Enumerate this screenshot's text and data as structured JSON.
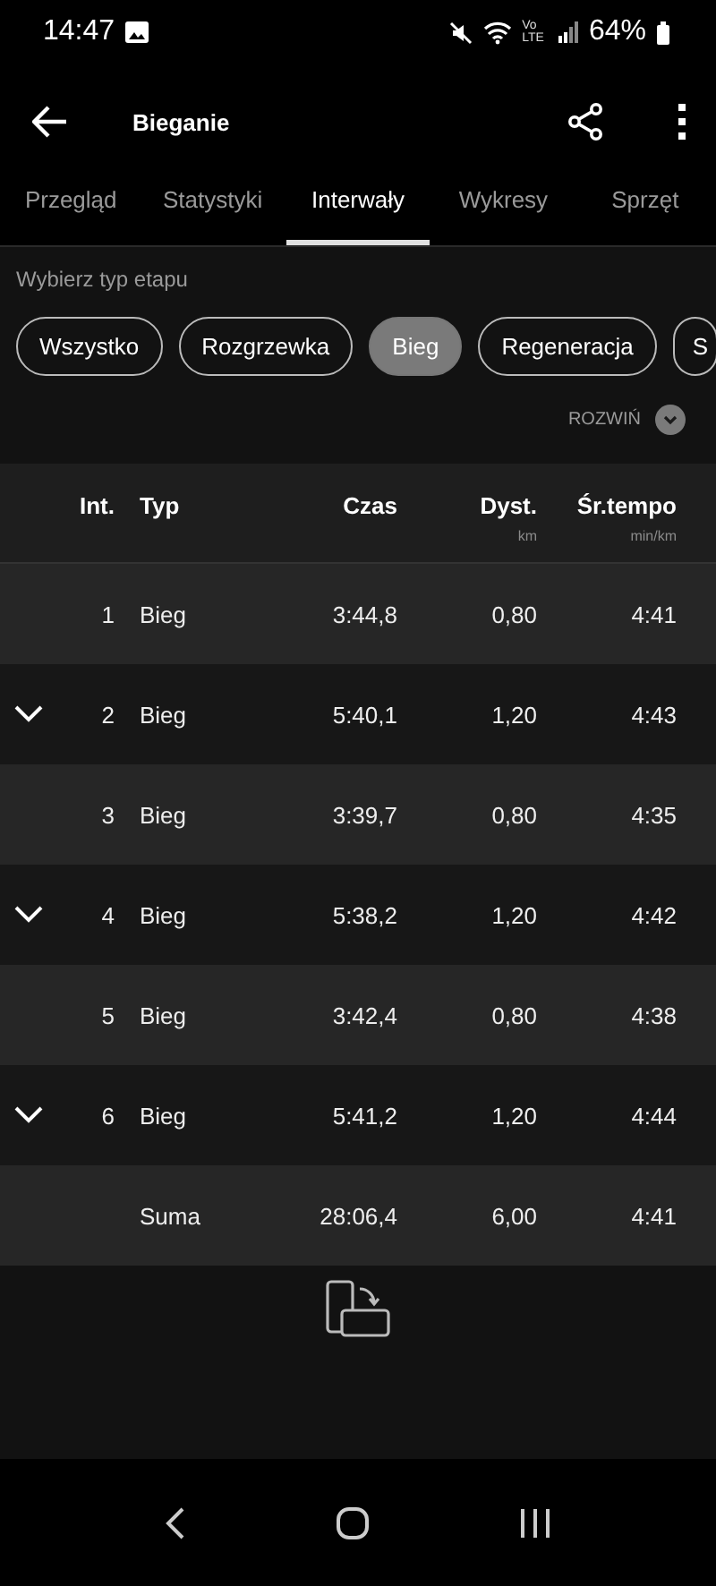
{
  "status_bar": {
    "time": "14:47",
    "volte_top": "Vo",
    "volte_bottom": "LTE",
    "battery": "64%"
  },
  "app_bar": {
    "title": "Bieganie"
  },
  "tabs": [
    {
      "label": "Przegląd",
      "selected": false
    },
    {
      "label": "Statystyki",
      "selected": false
    },
    {
      "label": "Interwały",
      "selected": true
    },
    {
      "label": "Wykresy",
      "selected": false
    },
    {
      "label": "Sprzęt",
      "selected": false
    }
  ],
  "filter": {
    "label": "Wybierz typ etapu",
    "chips": [
      {
        "label": "Wszystko",
        "selected": false
      },
      {
        "label": "Rozgrzewka",
        "selected": false
      },
      {
        "label": "Bieg",
        "selected": true
      },
      {
        "label": "Regeneracja",
        "selected": false
      },
      {
        "label": "S",
        "selected": false
      }
    ]
  },
  "expand_all": {
    "label": "ROZWIŃ"
  },
  "table": {
    "columns": [
      {
        "label": "Int."
      },
      {
        "label": "Typ"
      },
      {
        "label": "Czas"
      },
      {
        "label": "Dyst.",
        "unit": "km"
      },
      {
        "label": "Śr.tempo",
        "unit": "min/km"
      }
    ],
    "rows": [
      {
        "expandable": false,
        "int": "1",
        "type": "Bieg",
        "time": "3:44,8",
        "distance": "0,80",
        "pace": "4:41"
      },
      {
        "expandable": true,
        "int": "2",
        "type": "Bieg",
        "time": "5:40,1",
        "distance": "1,20",
        "pace": "4:43"
      },
      {
        "expandable": false,
        "int": "3",
        "type": "Bieg",
        "time": "3:39,7",
        "distance": "0,80",
        "pace": "4:35"
      },
      {
        "expandable": true,
        "int": "4",
        "type": "Bieg",
        "time": "5:38,2",
        "distance": "1,20",
        "pace": "4:42"
      },
      {
        "expandable": false,
        "int": "5",
        "type": "Bieg",
        "time": "3:42,4",
        "distance": "0,80",
        "pace": "4:38"
      },
      {
        "expandable": true,
        "int": "6",
        "type": "Bieg",
        "time": "5:41,2",
        "distance": "1,20",
        "pace": "4:44"
      }
    ],
    "total": {
      "label": "Suma",
      "time": "28:06,4",
      "distance": "6,00",
      "pace": "4:41"
    }
  }
}
